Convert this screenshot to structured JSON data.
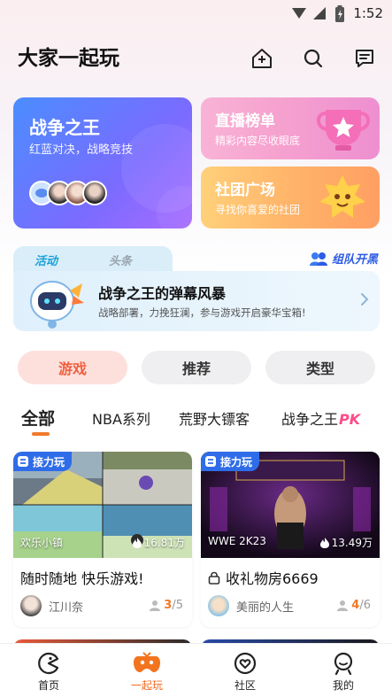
{
  "status_bar": {
    "time": "1:52"
  },
  "header": {
    "title": "大家一起玩"
  },
  "cards": {
    "war": {
      "title": "战争之王",
      "subtitle": "红蓝对决，战略竞技"
    },
    "live": {
      "title": "直播榜单",
      "subtitle": "精彩内容尽收眼底"
    },
    "club": {
      "title": "社团广场",
      "subtitle": "寻找你喜爱的社团"
    }
  },
  "banner": {
    "tab_activity": "活动",
    "tab_headline": "头条",
    "team_label": "组队开黑",
    "title": "战争之王的弹幕风暴",
    "subtitle": "战略部署，力挽狂澜，参与游戏开启豪华宝箱!"
  },
  "segments": [
    "游戏",
    "推荐",
    "类型"
  ],
  "categories": {
    "all": "全部",
    "items": [
      "NBA系列",
      "荒野大镖客",
      "战争之王"
    ],
    "pk_badge": "PK"
  },
  "game_cards": [
    {
      "tag": "接力玩",
      "name": "欢乐小镇",
      "heat": "16.81万",
      "title": "随时随地 快乐游戏!",
      "user": "江川奈",
      "count_current": "3",
      "count_total": "/5"
    },
    {
      "tag": "接力玩",
      "name": "WWE 2K23",
      "heat": "13.49万",
      "title": "收礼物房6669",
      "user": "美丽的人生",
      "count_current": "4",
      "count_total": "/6"
    }
  ],
  "bottom_nav": [
    {
      "label": "首页",
      "icon": "home-pacman-icon"
    },
    {
      "label": "一起玩",
      "icon": "gamepad-icon"
    },
    {
      "label": "社区",
      "icon": "community-heart-icon"
    },
    {
      "label": "我的",
      "icon": "profile-icon"
    }
  ],
  "colors": {
    "accent": "#f06a1e",
    "tag_blue": "#2f6de8",
    "segment_active_bg": "#fde0dc"
  }
}
